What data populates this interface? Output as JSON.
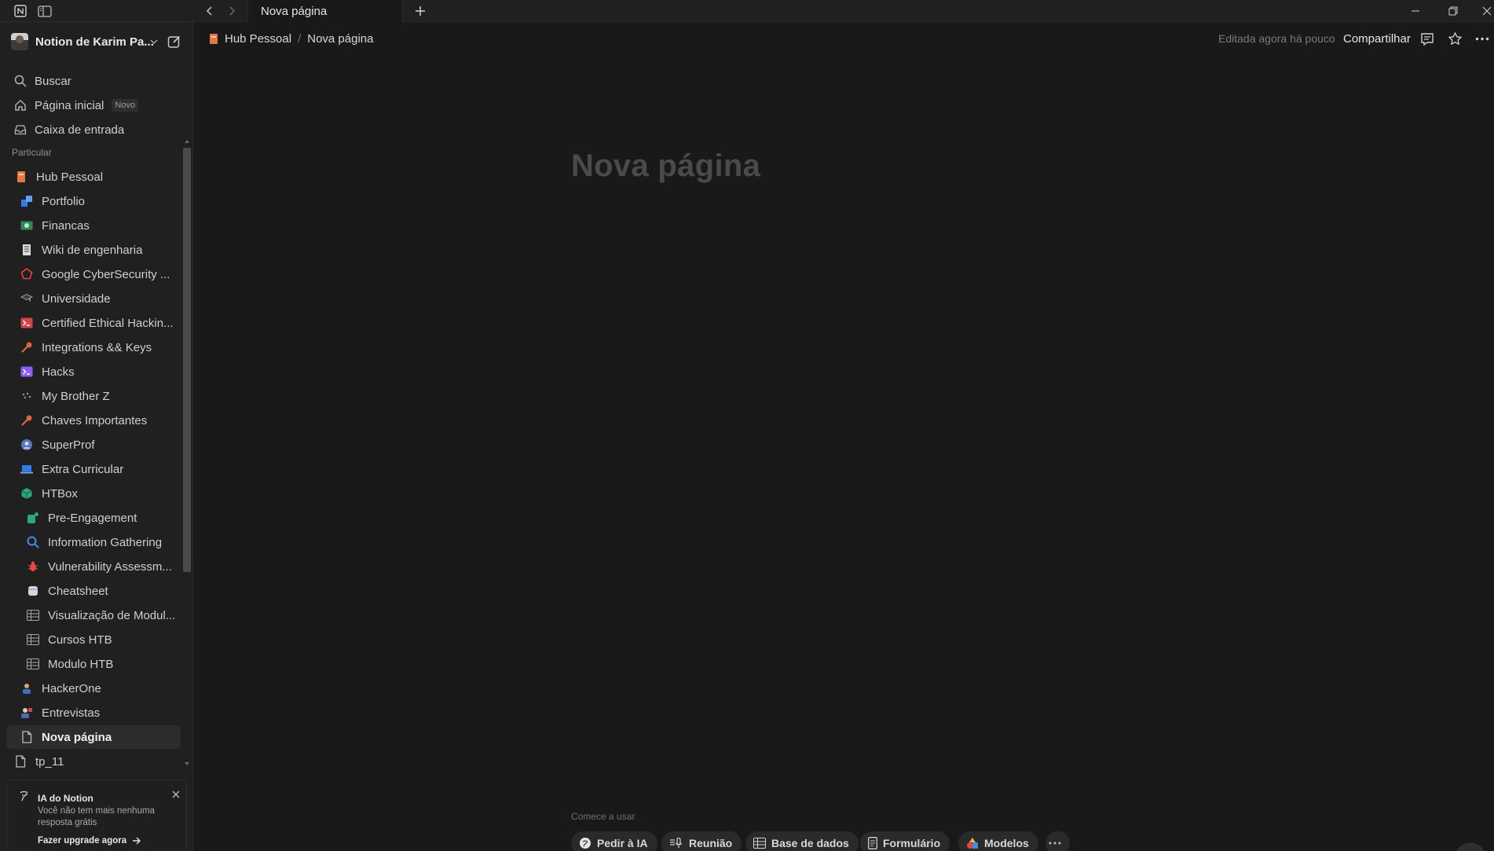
{
  "titlebar": {
    "tab_title": "Nova página"
  },
  "sidebar": {
    "workspace_name": "Notion de Karim Pa...",
    "nav": [
      {
        "label": "Buscar"
      },
      {
        "label": "Página inicial",
        "badge": "Novo"
      },
      {
        "label": "Caixa de entrada"
      }
    ],
    "section_label": "Particular",
    "pages": [
      {
        "label": "Hub Pessoal",
        "icon": "orange-book-icon"
      },
      {
        "label": "Portfolio",
        "icon": "portfolio-icon"
      },
      {
        "label": "Financas",
        "icon": "money-icon"
      },
      {
        "label": "Wiki de engenharia",
        "icon": "wiki-icon"
      },
      {
        "label": "Google CyberSecurity ...",
        "icon": "google-cyber-icon"
      },
      {
        "label": "Universidade",
        "icon": "graduation-cap-icon"
      },
      {
        "label": "Certified Ethical Hackin...",
        "icon": "terminal-red-icon"
      },
      {
        "label": "Integrations && Keys",
        "icon": "key-icon"
      },
      {
        "label": "Hacks",
        "icon": "terminal-purple-icon"
      },
      {
        "label": "My Brother Z",
        "icon": "my-brother-icon"
      },
      {
        "label": "Chaves Importantes",
        "icon": "key-icon"
      },
      {
        "label": "SuperProf",
        "icon": "superprof-icon"
      },
      {
        "label": "Extra Curricular",
        "icon": "laptop-icon"
      },
      {
        "label": "HTBox",
        "icon": "htbox-cube-icon"
      },
      {
        "label": "Pre-Engagement",
        "icon": "pre-engagement-icon"
      },
      {
        "label": "Information Gathering",
        "icon": "magnifier-icon"
      },
      {
        "label": "Vulnerability Assessm...",
        "icon": "bug-icon"
      },
      {
        "label": "Cheatsheet",
        "icon": "database-icon"
      },
      {
        "label": "Visualização de Modul...",
        "icon": "table-icon"
      },
      {
        "label": "Cursos HTB",
        "icon": "table-icon"
      },
      {
        "label": "Modulo HTB",
        "icon": "table-icon"
      },
      {
        "label": "HackerOne",
        "icon": "hackerone-icon"
      },
      {
        "label": "Entrevistas",
        "icon": "interview-icon"
      },
      {
        "label": "Nova página",
        "icon": "document-icon"
      },
      {
        "label": "tp_11",
        "icon": "document-icon"
      }
    ],
    "ai_card": {
      "title": "IA do Notion",
      "text": "Você não tem mais nenhuma resposta grátis",
      "cta": "Fazer upgrade agora"
    }
  },
  "topbar": {
    "breadcrumb_parent": "Hub Pessoal",
    "breadcrumb_sep": "/",
    "breadcrumb_current": "Nova página",
    "edited_status": "Editada agora há pouco",
    "share_label": "Compartilhar"
  },
  "main": {
    "title_placeholder": "Nova página",
    "start_label": "Comece a usar",
    "chips": [
      {
        "label": "Pedir à IA"
      },
      {
        "label": "Reunião"
      },
      {
        "label": "Base de dados"
      },
      {
        "label": "Formulário"
      },
      {
        "label": "Modelos"
      }
    ]
  },
  "colors": {
    "background": "#191919",
    "sidebar": "#202020",
    "title_placeholder": "#4a4a4a"
  }
}
